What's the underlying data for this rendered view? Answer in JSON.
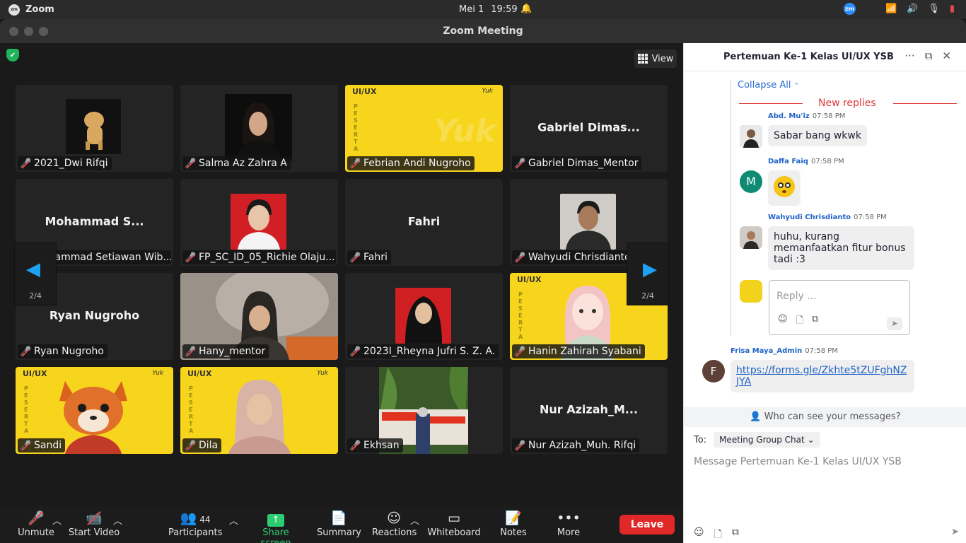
{
  "os_bar": {
    "app_name": "Zoom",
    "date": "Mei 1",
    "time": "19:59",
    "zoom_tray": "zm"
  },
  "window": {
    "title": "Zoom Meeting"
  },
  "stage": {
    "view_label": "View",
    "page_left": "2/4",
    "page_right": "2/4",
    "tiles": [
      {
        "name": "2021_Dwi Rifqi",
        "big": ""
      },
      {
        "name": "Salma Az Zahra A",
        "big": ""
      },
      {
        "name": "Febrian Andi Nugroho",
        "big": ""
      },
      {
        "name": "Gabriel Dimas_Mentor",
        "big": "Gabriel Dimas..."
      },
      {
        "name": "Mohammad Setiawan Wib...",
        "big": "Mohammad S..."
      },
      {
        "name": "FP_SC_ID_05_Richie Olaju...",
        "big": ""
      },
      {
        "name": "Fahri",
        "big": "Fahri"
      },
      {
        "name": "Wahyudi Chrisdianto",
        "big": ""
      },
      {
        "name": "Ryan Nugroho",
        "big": "Ryan Nugroho"
      },
      {
        "name": "Hany_mentor",
        "big": ""
      },
      {
        "name": "2023I_Rheyna Jufri S. Z. A.",
        "big": ""
      },
      {
        "name": "Hanin Zahirah Syabani",
        "big": ""
      },
      {
        "name": "Sandi",
        "big": ""
      },
      {
        "name": "Dila",
        "big": ""
      },
      {
        "name": "Ekhsan",
        "big": ""
      },
      {
        "name": "Nur Azizah_Muh. Rifqi",
        "big": "Nur Azizah_M..."
      }
    ],
    "uiux_label": "UI/UX",
    "yuk_label": "Yuk",
    "peserta_label": "PESERTA"
  },
  "toolbar": {
    "unmute": "Unmute",
    "start_video": "Start Video",
    "participants": "Participants",
    "participants_count": "44",
    "share_screen": "Share screen",
    "summary": "Summary",
    "reactions": "Reactions",
    "whiteboard": "Whiteboard",
    "notes": "Notes",
    "more": "More",
    "leave": "Leave"
  },
  "chat": {
    "title": "Pertemuan Ke-1 Kelas UI/UX YSB",
    "collapse_all": "Collapse All",
    "new_replies": "New replies",
    "messages": [
      {
        "sender": "Abd. Mu'iz",
        "time": "07:58 PM",
        "text": "Sabar bang wkwk"
      },
      {
        "sender": "Daffa Faiq",
        "time": "07:58 PM",
        "avatar_letter": "M",
        "text": ""
      },
      {
        "sender": "Wahyudi Chrisdianto",
        "time": "07:58 PM",
        "text": "huhu, kurang memanfaatkan fitur bonus tadi :3"
      },
      {
        "sender": "Frisa Maya_Admin",
        "time": "07:58 PM",
        "avatar_letter": "F",
        "text": "https://forms.gle/Zkhte5tZUFghNZJYA"
      }
    ],
    "reply_placeholder": "Reply ...",
    "who_can_see": "Who can see your messages?",
    "to_label": "To:",
    "to_value": "Meeting Group Chat",
    "compose_placeholder": "Message Pertemuan Ke-1 Kelas UI/UX YSB",
    "colors": {
      "accent": "#2d8cff",
      "leave": "#e02828",
      "share": "#2ecc71",
      "new_replies": "#e03535"
    }
  }
}
